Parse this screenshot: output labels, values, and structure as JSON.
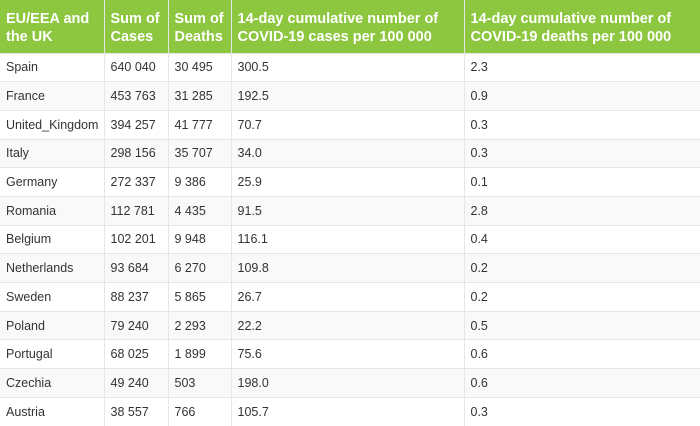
{
  "table": {
    "headers": [
      "EU/EEA and the UK",
      "Sum of Cases",
      "Sum of Deaths",
      "14-day cumulative number of COVID-19 cases per 100 000",
      "14-day cumulative number of COVID-19 deaths per 100 000"
    ],
    "rows": [
      [
        "Spain",
        "640 040",
        "30 495",
        "300.5",
        "2.3"
      ],
      [
        "France",
        "453 763",
        "31 285",
        "192.5",
        "0.9"
      ],
      [
        "United_Kingdom",
        "394 257",
        "41 777",
        "70.7",
        "0.3"
      ],
      [
        "Italy",
        "298 156",
        "35 707",
        "34.0",
        "0.3"
      ],
      [
        "Germany",
        "272 337",
        "9 386",
        "25.9",
        "0.1"
      ],
      [
        "Romania",
        "112 781",
        "4 435",
        "91.5",
        "2.8"
      ],
      [
        "Belgium",
        "102 201",
        "9 948",
        "116.1",
        "0.4"
      ],
      [
        "Netherlands",
        "93 684",
        "6 270",
        "109.8",
        "0.2"
      ],
      [
        "Sweden",
        "88 237",
        "5 865",
        "26.7",
        "0.2"
      ],
      [
        "Poland",
        "79 240",
        "2 293",
        "22.2",
        "0.5"
      ],
      [
        "Portugal",
        "68 025",
        "1 899",
        "75.6",
        "0.6"
      ],
      [
        "Czechia",
        "49 240",
        "503",
        "198.0",
        "0.6"
      ],
      [
        "Austria",
        "38 557",
        "766",
        "105.7",
        "0.3"
      ]
    ]
  },
  "colors": {
    "header_bg": "#8dc63f",
    "header_text": "#ffffff",
    "border": "#e6e6e6"
  }
}
